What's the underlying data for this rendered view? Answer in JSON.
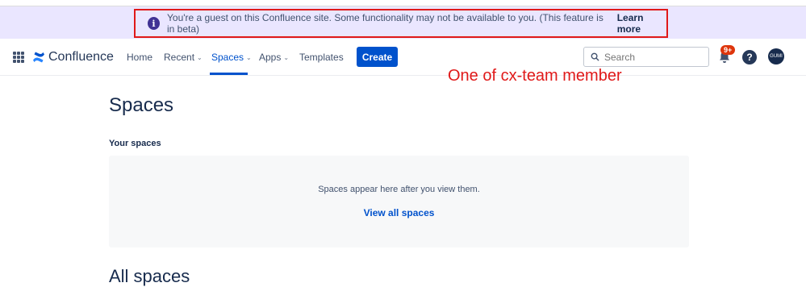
{
  "banner": {
    "info_icon": "i",
    "message": "You're a guest on this Confluence site. Some functionality may not be available to you. (This feature is in beta)",
    "link": "Learn more"
  },
  "nav": {
    "app_name": "Confluence",
    "items": [
      {
        "label": "Home"
      },
      {
        "label": "Recent",
        "chevron": "⌄"
      },
      {
        "label": "Spaces",
        "chevron": "⌄"
      },
      {
        "label": "Apps",
        "chevron": "⌄"
      },
      {
        "label": "Templates"
      }
    ],
    "create_label": "Create",
    "search_placeholder": "Search",
    "notification_count": "9+",
    "help_glyph": "?",
    "avatar_initials": "GUMI",
    "accent_color": "#0052cc"
  },
  "annotation": "One of cx-team member",
  "main": {
    "title": "Spaces",
    "your_spaces_label": "Your spaces",
    "empty_message": "Spaces appear here after you view them.",
    "view_all_link": "View all spaces",
    "all_spaces_title": "All spaces"
  }
}
